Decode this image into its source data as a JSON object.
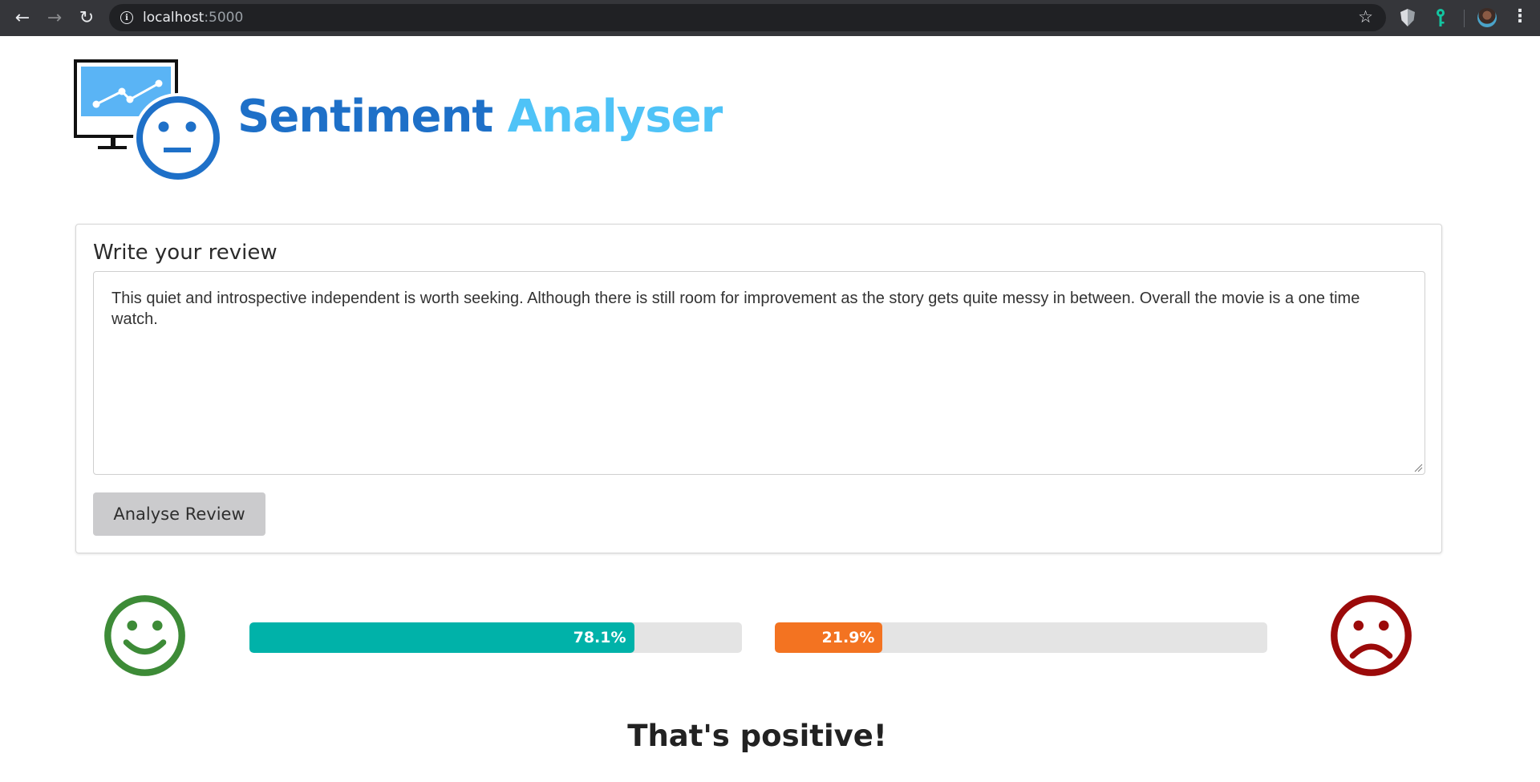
{
  "browser": {
    "url_host": "localhost",
    "url_port": ":5000",
    "icons": [
      "back-arrow-icon",
      "forward-arrow-icon",
      "reload-icon",
      "info-icon",
      "star-icon",
      "shield-extension-icon",
      "key-extension-icon",
      "profile-avatar",
      "menu-dots-icon"
    ]
  },
  "header": {
    "title_part1": "Sentiment ",
    "title_part2": "Analyser",
    "logo_icon": "monitor-chart-neutral-face-logo"
  },
  "form": {
    "heading": "Write your review",
    "review_text": "This quiet and introspective independent is worth seeking. Although there is still room for improvement as the story gets quite messy in between. Overall the movie is a one time watch.",
    "submit_label": "Analyse Review"
  },
  "results": {
    "positive": {
      "fraction": 0.781,
      "label": "78.1%",
      "color": "#00b2a9",
      "icon": "happy-face-icon",
      "icon_color": "#3d8b37"
    },
    "negative": {
      "fraction": 0.219,
      "label": "21.9%",
      "color": "#f37321",
      "icon": "sad-face-icon",
      "icon_color": "#9b0a0a"
    },
    "verdict": "That's positive!"
  },
  "colors": {
    "brand_dark": "#1e70c8",
    "brand_light": "#4fc3f7"
  }
}
